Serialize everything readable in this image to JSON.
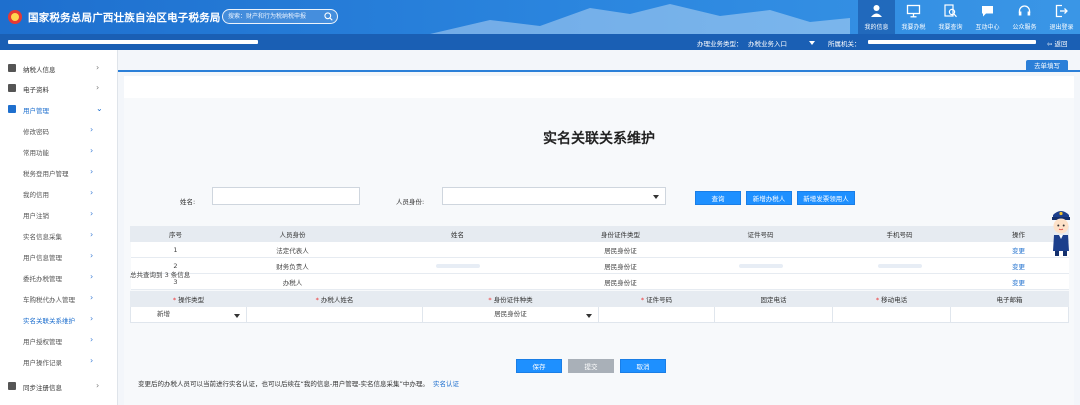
{
  "header": {
    "title": "国家税务总局广西壮族自治区电子税务局",
    "search_placeholder": "搜索：财产和行为税纳税申报",
    "nav": [
      {
        "label": "我的信息",
        "icon": "user-icon",
        "active": true
      },
      {
        "label": "我要办税",
        "icon": "monitor-icon"
      },
      {
        "label": "我要查询",
        "icon": "magnifier-doc-icon"
      },
      {
        "label": "互动中心",
        "icon": "chat-icon"
      },
      {
        "label": "公众服务",
        "icon": "headset-icon"
      },
      {
        "label": "退出登录",
        "icon": "logout-icon"
      }
    ]
  },
  "subbar": {
    "business_type_label": "办理业务类型：",
    "business_type_value": "办税业务入口",
    "tax_authority_label": "所属机关：",
    "back_label": "返回"
  },
  "sidebar": {
    "items": [
      {
        "label": "纳税人信息",
        "icon": "id-card-icon"
      },
      {
        "label": "电子资料",
        "icon": "document-icon"
      },
      {
        "label": "用户管理",
        "icon": "user-manage-icon",
        "open": true
      }
    ],
    "sub_items": [
      "修改密码",
      "常用功能",
      "税务登用户管理",
      "我的信用",
      "用户注销",
      "实名信息采集",
      "用户信息管理",
      "委托办税管理",
      "车购税代办人管理",
      "实名关联关系维护",
      "用户授权管理",
      "用户操作记录"
    ],
    "current": "实名关联关系维护",
    "bottom_items": [
      {
        "label": "同步注册信息",
        "icon": "sync-icon"
      }
    ]
  },
  "main": {
    "tab_label": "去单填写",
    "title": "实名关联关系维护",
    "query": {
      "name_label": "姓名:",
      "name_value": "",
      "role_label": "人员身份:",
      "role_value": ""
    },
    "buttons": {
      "search": "查询",
      "add_agent": "新增办税人",
      "add_ticket": "新增发票领用人"
    },
    "table1": {
      "headers": [
        "序号",
        "人员身份",
        "姓名",
        "身份证件类型",
        "证件号码",
        "手机号码",
        "操作"
      ],
      "rows": [
        {
          "no": "1",
          "role": "法定代表人",
          "id_type": "居民身份证",
          "action": "变更"
        },
        {
          "no": "2",
          "role": "财务负责人",
          "id_type": "居民身份证",
          "action": "变更"
        },
        {
          "no": "3",
          "role": "办税人",
          "id_type": "居民身份证",
          "action": "变更"
        }
      ]
    },
    "count_text": "总共查询到 3 条信息",
    "table2": {
      "headers": [
        {
          "label": "操作类型",
          "required": true
        },
        {
          "label": "办税人姓名",
          "required": true
        },
        {
          "label": "身份证件种类",
          "required": true
        },
        {
          "label": "证件号码",
          "required": true
        },
        {
          "label": "固定电话",
          "required": false
        },
        {
          "label": "移动电话",
          "required": true
        },
        {
          "label": "电子邮箱",
          "required": false
        }
      ],
      "row": {
        "op_type": "新增",
        "id_kind": "居民身份证"
      }
    },
    "form_buttons": {
      "save": "保存",
      "submit": "提交",
      "cancel": "取消"
    },
    "note": "变更后的办税人员可以当前进行实名认证，也可以后续在“我的信息-用户管理-实名信息采集”中办理。",
    "note_link": "实名认证"
  }
}
